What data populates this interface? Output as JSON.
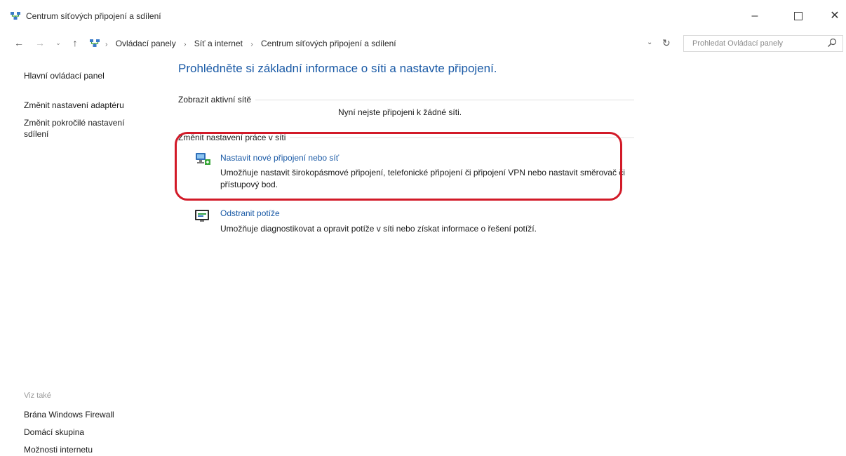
{
  "window": {
    "title": "Centrum síťových připojení a sdílení",
    "min_glyph": "–",
    "close_glyph": "✕"
  },
  "nav": {
    "back_glyph": "←",
    "forward_glyph": "→",
    "recent_glyph": "⌄",
    "up_glyph": "↑",
    "dropdown_glyph": "⌄",
    "refresh_glyph": "↻",
    "breadcrumbs": [
      "Ovládací panely",
      "Síť a internet",
      "Centrum síťových připojení a sdílení"
    ],
    "separator": "›",
    "search_placeholder": "Prohledat Ovládací panely"
  },
  "sidebar": {
    "links": [
      "Hlavní ovládací panel",
      "Změnit nastavení adaptéru",
      "Změnit pokročilé nastavení sdílení"
    ],
    "see_also_title": "Viz také",
    "see_also": [
      "Brána Windows Firewall",
      "Domácí skupina",
      "Možnosti internetu"
    ]
  },
  "main": {
    "title": "Prohlédněte si základní informace o síti a nastavte připojení.",
    "active_networks_title": "Zobrazit aktivní sítě",
    "no_network_text": "Nyní nejste připojeni k žádné síti.",
    "change_settings_title": "Změnit nastavení práce v síti",
    "tasks": [
      {
        "link": "Nastavit nové připojení nebo síť",
        "description": "Umožňuje nastavit širokopásmové připojení, telefonické připojení či připojení VPN nebo nastavit směrovač či přístupový bod.",
        "icon": "network-setup-icon"
      },
      {
        "link": "Odstranit potíže",
        "description": "Umožňuje diagnostikovat a opravit potíže v síti nebo získat informace o řešení potíží.",
        "icon": "troubleshoot-icon"
      }
    ]
  },
  "colors": {
    "link": "#1a5aa6",
    "highlight": "#d21a28",
    "text": "#1b1b1b"
  }
}
